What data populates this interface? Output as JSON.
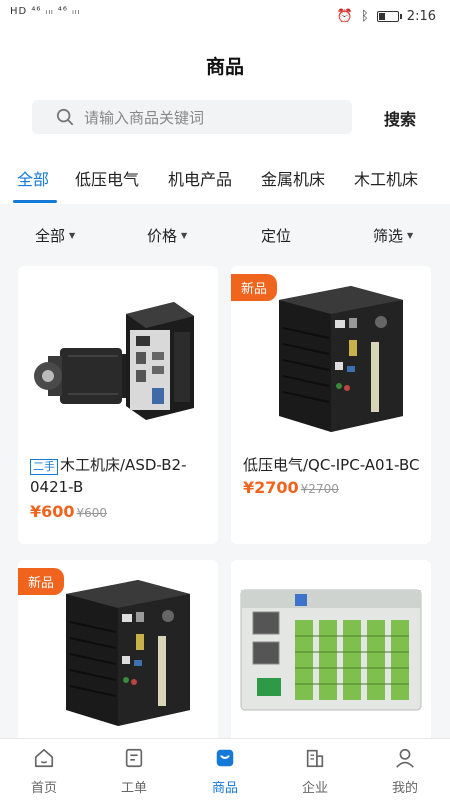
{
  "status_bar": {
    "left": "HD ⁴⁶ ᵢₗₗ ⁴⁶ ᵢₗₗ",
    "time": "2:16",
    "battery_level": 0.35
  },
  "header": {
    "title": "商品"
  },
  "search": {
    "placeholder": "请输入商品关键词",
    "value": "",
    "button_label": "搜索"
  },
  "category_tabs": [
    {
      "label": "全部",
      "active": true
    },
    {
      "label": "低压电气",
      "active": false
    },
    {
      "label": "机电产品",
      "active": false
    },
    {
      "label": "金属机床",
      "active": false
    },
    {
      "label": "木工机床",
      "active": false
    }
  ],
  "filters": [
    {
      "label": "全部",
      "has_caret": true
    },
    {
      "label": "价格",
      "has_caret": true
    },
    {
      "label": "定位",
      "has_caret": false
    },
    {
      "label": "筛选",
      "has_caret": true
    }
  ],
  "products": [
    {
      "badge": "",
      "tag": "二手",
      "name": "木工机床/ASD-B2-0421-B",
      "price": "¥600",
      "original_price": "¥600",
      "image": "servo-motor-drive"
    },
    {
      "badge": "新品",
      "tag": "",
      "name": "低压电气/QC-IPC-A01-BC",
      "price": "¥2700",
      "original_price": "¥2700",
      "image": "industrial-pc"
    },
    {
      "badge": "新品",
      "tag": "",
      "name": "",
      "price": "",
      "original_price": "",
      "image": "industrial-pc"
    },
    {
      "badge": "",
      "tag": "",
      "name": "",
      "price": "",
      "original_price": "",
      "image": "digital-output-module"
    }
  ],
  "bottom_nav": [
    {
      "label": "首页",
      "icon": "home-icon",
      "active": false
    },
    {
      "label": "工单",
      "icon": "work-order-icon",
      "active": false
    },
    {
      "label": "商品",
      "icon": "product-icon",
      "active": true
    },
    {
      "label": "企业",
      "icon": "enterprise-icon",
      "active": false
    },
    {
      "label": "我的",
      "icon": "profile-icon",
      "active": false
    }
  ],
  "colors": {
    "accent": "#1479d7",
    "price": "#f0641e",
    "badge": "#f0641e"
  }
}
